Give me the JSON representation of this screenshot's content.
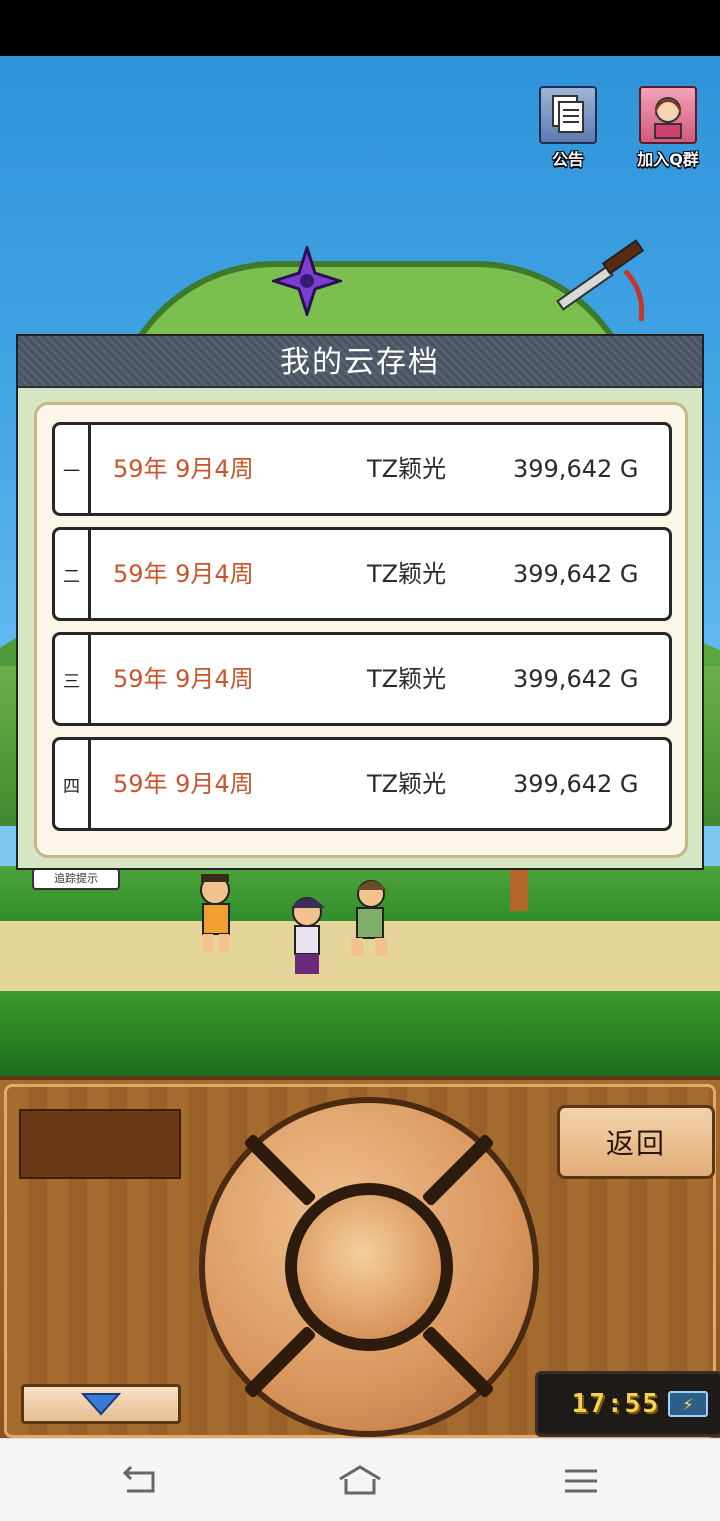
{
  "top_icons": {
    "notice_label": "公告",
    "qq_group_label": "加入Q群"
  },
  "scene": {
    "hint_badge": "追踪提示"
  },
  "dialog": {
    "title": "我的云存档",
    "slots": [
      {
        "number": "一",
        "date": "59年 9月4周",
        "name": "TZ颖光",
        "money": "399,642 G"
      },
      {
        "number": "二",
        "date": "59年 9月4周",
        "name": "TZ颖光",
        "money": "399,642 G"
      },
      {
        "number": "三",
        "date": "59年 9月4周",
        "name": "TZ颖光",
        "money": "399,642 G"
      },
      {
        "number": "四",
        "date": "59年 9月4周",
        "name": "TZ颖光",
        "money": "399,642 G"
      }
    ]
  },
  "console": {
    "back_label": "返回",
    "clock": "17:55"
  },
  "colors": {
    "date_text": "#c8552c",
    "sky": "#43a6e6",
    "wood": "#a86c30"
  }
}
